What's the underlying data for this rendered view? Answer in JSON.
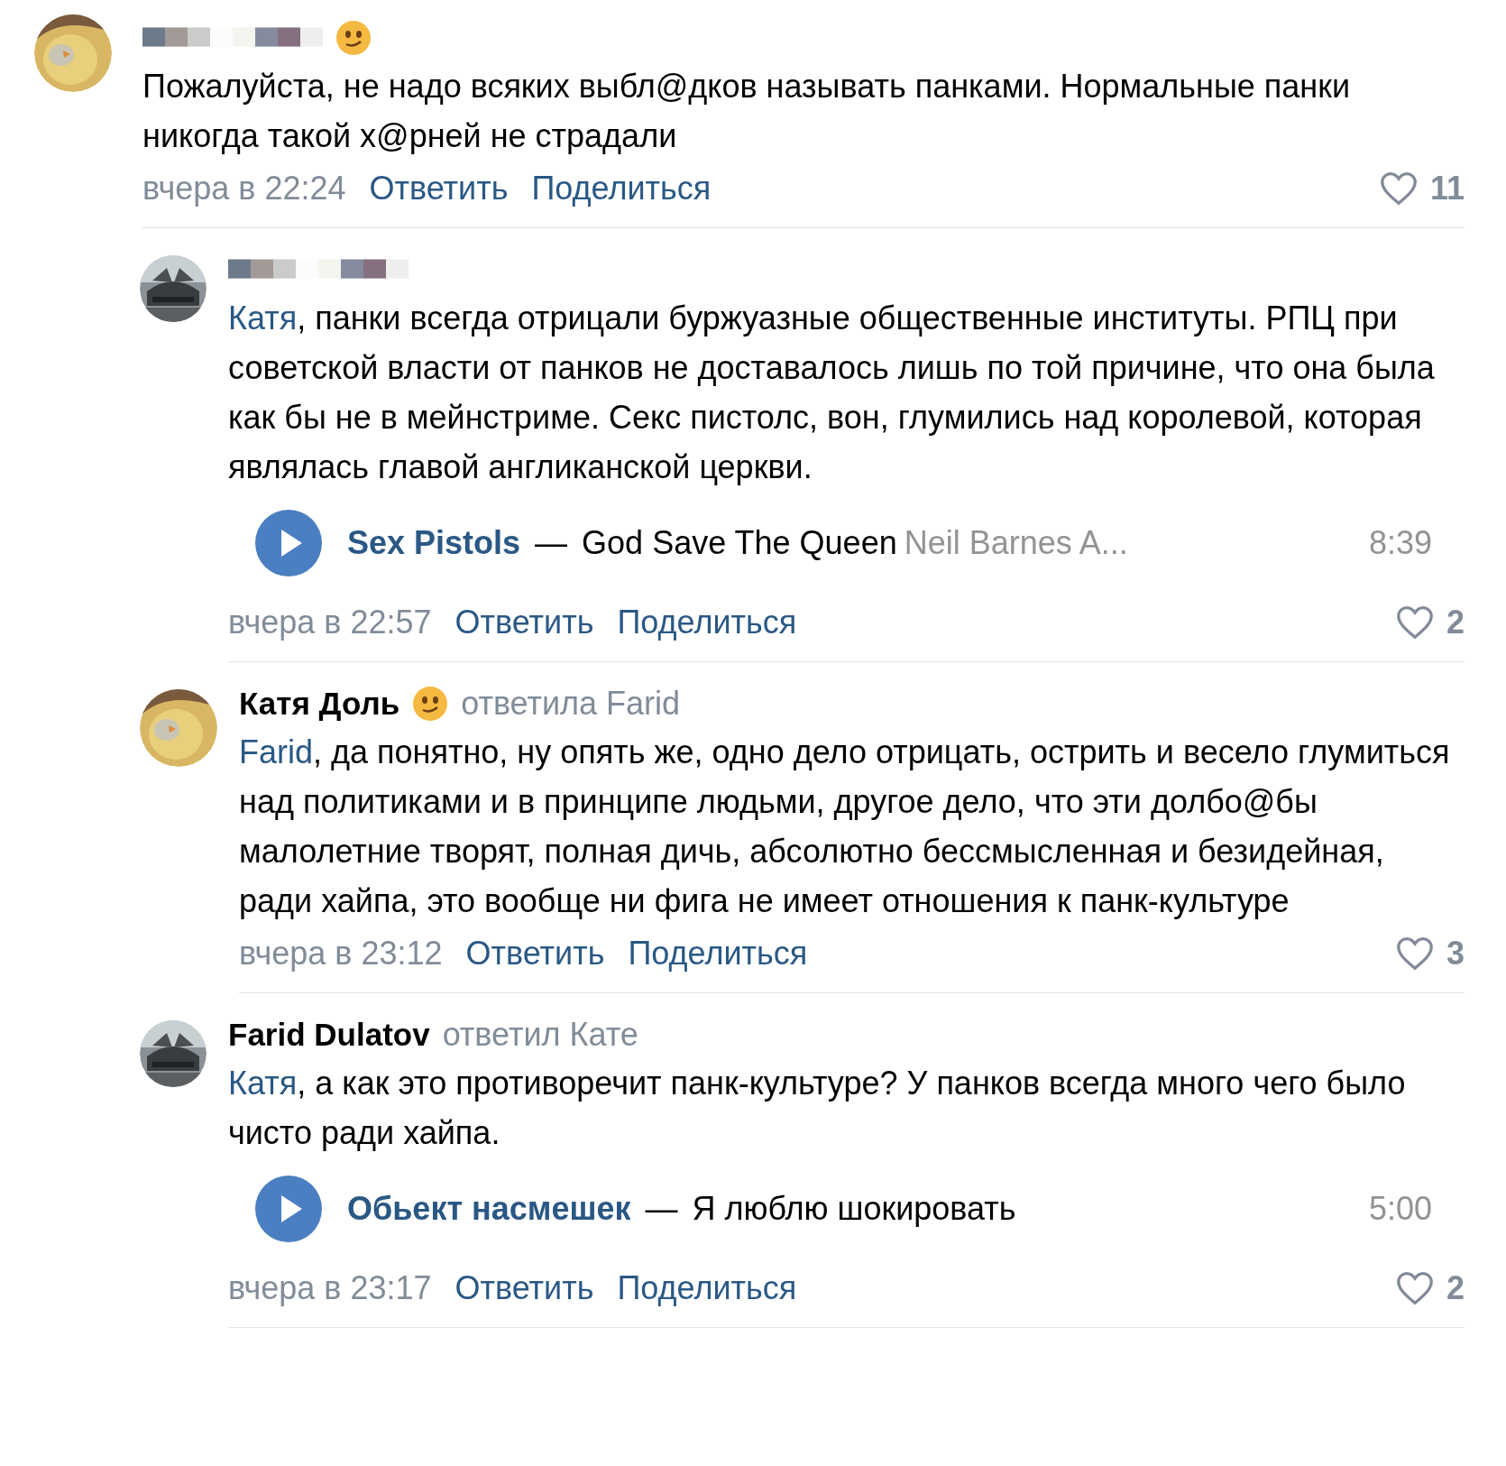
{
  "comments": [
    {
      "author": {
        "emoji": true
      },
      "avatar": {
        "kind": "chick"
      },
      "text": "Пожалуйста, не надо всяких выбл@дков называть панками. Нормальные панки никогда такой х@рней не страдали",
      "time": "вчера в 22:24",
      "reply": "Ответить",
      "share": "Поделиться",
      "likes": "11",
      "nested": false
    },
    {
      "author": {
        "emoji": false
      },
      "avatar": {
        "kind": "car"
      },
      "mention": "Катя",
      "text": ", панки всегда отрицали буржуазные общественные институты. РПЦ при советской власти от панков не доставалось лишь по той причине, что она была как бы не в мейнстриме. Секс пистолс, вон, глумились над королевой, которая являлась главой англиканской церкви.",
      "audio": {
        "artist": "Sex Pistols",
        "dash": "—",
        "title": "God Save The Queen",
        "subtitle": "Neil Barnes A...",
        "duration": "8:39"
      },
      "time": "вчера в 22:57",
      "reply": "Ответить",
      "share": "Поделиться",
      "likes": "2",
      "nested": true
    },
    {
      "author": {
        "name": "Катя Доль",
        "emoji": true
      },
      "reply_to": "ответила Farid",
      "avatar": {
        "kind": "chick"
      },
      "mention": "Farid",
      "text": ", да понятно, ну опять же, одно дело отрицать, острить и весело глумиться над политиками и в принципе людьми, другое дело, что эти долбо@бы малолетние творят, полная дичь, абсолютно бессмысленная и безидейная, ради хайпа, это вообще ни фига не имеет отношения к панк-культуре",
      "time": "вчера в 23:12",
      "reply": "Ответить",
      "share": "Поделиться",
      "likes": "3",
      "nested": true
    },
    {
      "author": {
        "name": "Farid Dulatov",
        "emoji": false
      },
      "reply_to": "ответил Кате",
      "avatar": {
        "kind": "car"
      },
      "mention": "Катя",
      "text": ", а как это противоречит панк-культуре? У панков всегда много чего было чисто ради хайпа.",
      "audio": {
        "artist": "Обьект насмешек",
        "dash": "—",
        "title": "Я люблю шокировать",
        "duration": "5:00"
      },
      "time": "вчера в 23:17",
      "reply": "Ответить",
      "share": "Поделиться",
      "likes": "2",
      "nested": true
    }
  ]
}
